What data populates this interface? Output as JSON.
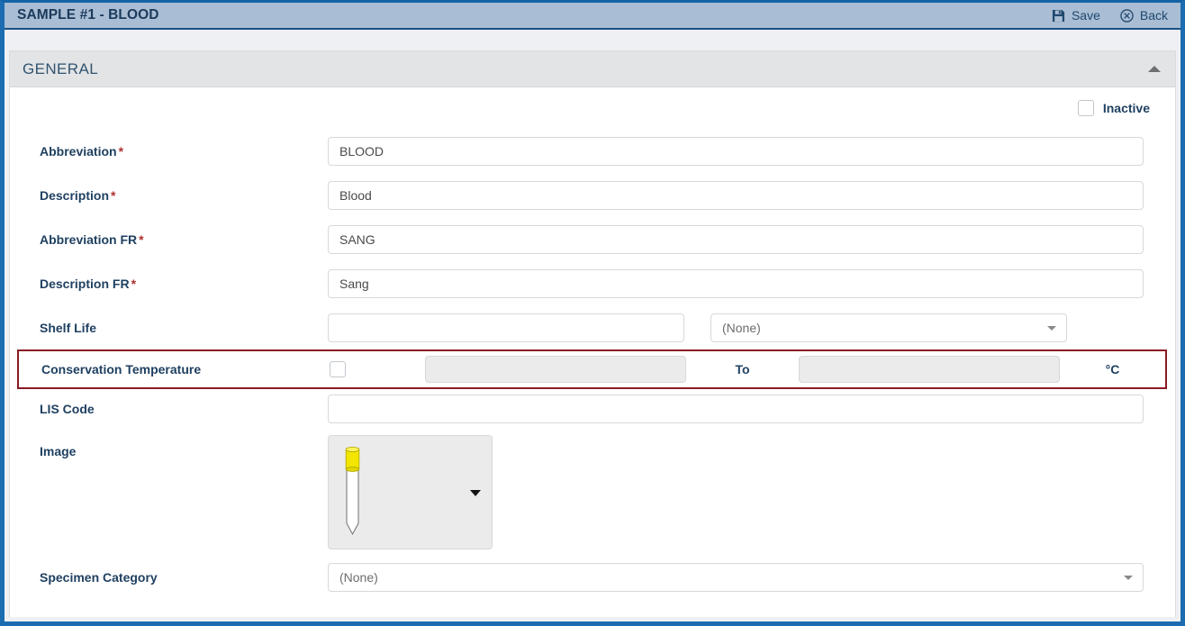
{
  "window": {
    "title": "SAMPLE #1 - BLOOD",
    "actions": [
      {
        "label": "Save",
        "icon": "save-floppy-icon"
      },
      {
        "label": "Back",
        "icon": "circle-x-icon"
      }
    ]
  },
  "panel": {
    "title": "GENERAL",
    "collapse_icon": "caret-up-icon",
    "inactive": {
      "label": "Inactive",
      "checked": false
    }
  },
  "fields": {
    "abbreviation": {
      "label": "Abbreviation",
      "required": "*",
      "value": "BLOOD"
    },
    "description": {
      "label": "Description",
      "required": "*",
      "value": "Blood"
    },
    "abbreviation_fr": {
      "label": "Abbreviation FR",
      "required": "*",
      "value": "SANG"
    },
    "description_fr": {
      "label": "Description FR",
      "required": "*",
      "value": "Sang"
    },
    "shelf_life": {
      "label": "Shelf Life",
      "value": "",
      "unit_value": "(None)"
    },
    "conservation_temperature": {
      "label": "Conservation Temperature",
      "checked": false,
      "from_value": "",
      "to_label": "To",
      "to_value": "",
      "unit": "°C"
    },
    "lis_code": {
      "label": "LIS Code",
      "value": ""
    },
    "image": {
      "label": "Image",
      "icon": "test-tube-yellow-cap-icon",
      "dropdown_icon": "caret-down-icon"
    },
    "specimen_category": {
      "label": "Specimen Category",
      "value": "(None)"
    }
  },
  "colors": {
    "titlebar_bg": "#a9bdd4",
    "titlebar_text": "#1b3a5c",
    "app_border": "#1b6cb0",
    "panel_header_bg": "#e3e4e6",
    "label_text": "#1f4061",
    "required_asterisk": "#b03030",
    "highlight_border": "#8b1a23",
    "tube_cap": "#f2e500",
    "disabled_input_bg": "#ebebeb"
  }
}
